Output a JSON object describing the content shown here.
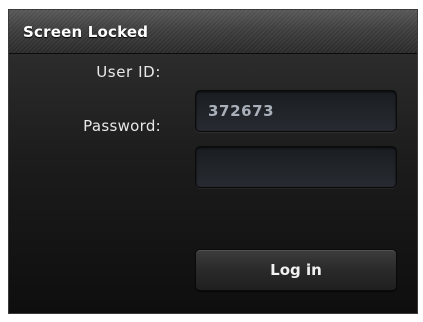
{
  "dialog": {
    "title": "Screen Locked"
  },
  "form": {
    "user_id_label": "User ID:",
    "user_id_value": "372673",
    "password_label": "Password:",
    "password_value": ""
  },
  "actions": {
    "login_label": "Log in"
  }
}
